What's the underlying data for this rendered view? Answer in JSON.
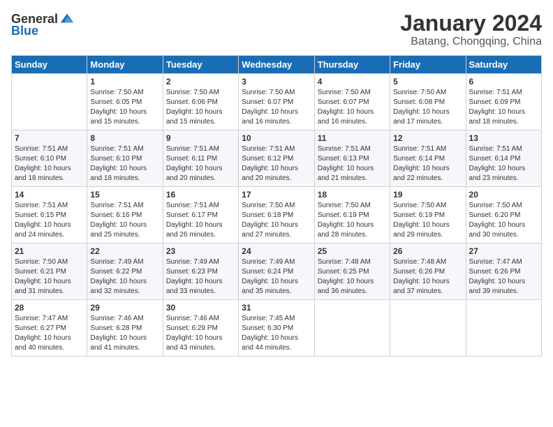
{
  "header": {
    "logo_general": "General",
    "logo_blue": "Blue",
    "title": "January 2024",
    "subtitle": "Batang, Chongqing, China"
  },
  "calendar": {
    "days_of_week": [
      "Sunday",
      "Monday",
      "Tuesday",
      "Wednesday",
      "Thursday",
      "Friday",
      "Saturday"
    ],
    "weeks": [
      [
        {
          "day": "",
          "sunrise": "",
          "sunset": "",
          "daylight": ""
        },
        {
          "day": "1",
          "sunrise": "7:50 AM",
          "sunset": "6:05 PM",
          "daylight": "10 hours and 15 minutes."
        },
        {
          "day": "2",
          "sunrise": "7:50 AM",
          "sunset": "6:06 PM",
          "daylight": "10 hours and 15 minutes."
        },
        {
          "day": "3",
          "sunrise": "7:50 AM",
          "sunset": "6:07 PM",
          "daylight": "10 hours and 16 minutes."
        },
        {
          "day": "4",
          "sunrise": "7:50 AM",
          "sunset": "6:07 PM",
          "daylight": "10 hours and 16 minutes."
        },
        {
          "day": "5",
          "sunrise": "7:50 AM",
          "sunset": "6:08 PM",
          "daylight": "10 hours and 17 minutes."
        },
        {
          "day": "6",
          "sunrise": "7:51 AM",
          "sunset": "6:09 PM",
          "daylight": "10 hours and 18 minutes."
        }
      ],
      [
        {
          "day": "7",
          "sunrise": "7:51 AM",
          "sunset": "6:10 PM",
          "daylight": "10 hours and 18 minutes."
        },
        {
          "day": "8",
          "sunrise": "7:51 AM",
          "sunset": "6:10 PM",
          "daylight": "10 hours and 18 minutes."
        },
        {
          "day": "9",
          "sunrise": "7:51 AM",
          "sunset": "6:11 PM",
          "daylight": "10 hours and 20 minutes."
        },
        {
          "day": "10",
          "sunrise": "7:51 AM",
          "sunset": "6:12 PM",
          "daylight": "10 hours and 20 minutes."
        },
        {
          "day": "11",
          "sunrise": "7:51 AM",
          "sunset": "6:13 PM",
          "daylight": "10 hours and 21 minutes."
        },
        {
          "day": "12",
          "sunrise": "7:51 AM",
          "sunset": "6:14 PM",
          "daylight": "10 hours and 22 minutes."
        },
        {
          "day": "13",
          "sunrise": "7:51 AM",
          "sunset": "6:14 PM",
          "daylight": "10 hours and 23 minutes."
        }
      ],
      [
        {
          "day": "14",
          "sunrise": "7:51 AM",
          "sunset": "6:15 PM",
          "daylight": "10 hours and 24 minutes."
        },
        {
          "day": "15",
          "sunrise": "7:51 AM",
          "sunset": "6:16 PM",
          "daylight": "10 hours and 25 minutes."
        },
        {
          "day": "16",
          "sunrise": "7:51 AM",
          "sunset": "6:17 PM",
          "daylight": "10 hours and 26 minutes."
        },
        {
          "day": "17",
          "sunrise": "7:50 AM",
          "sunset": "6:18 PM",
          "daylight": "10 hours and 27 minutes."
        },
        {
          "day": "18",
          "sunrise": "7:50 AM",
          "sunset": "6:19 PM",
          "daylight": "10 hours and 28 minutes."
        },
        {
          "day": "19",
          "sunrise": "7:50 AM",
          "sunset": "6:19 PM",
          "daylight": "10 hours and 29 minutes."
        },
        {
          "day": "20",
          "sunrise": "7:50 AM",
          "sunset": "6:20 PM",
          "daylight": "10 hours and 30 minutes."
        }
      ],
      [
        {
          "day": "21",
          "sunrise": "7:50 AM",
          "sunset": "6:21 PM",
          "daylight": "10 hours and 31 minutes."
        },
        {
          "day": "22",
          "sunrise": "7:49 AM",
          "sunset": "6:22 PM",
          "daylight": "10 hours and 32 minutes."
        },
        {
          "day": "23",
          "sunrise": "7:49 AM",
          "sunset": "6:23 PM",
          "daylight": "10 hours and 33 minutes."
        },
        {
          "day": "24",
          "sunrise": "7:49 AM",
          "sunset": "6:24 PM",
          "daylight": "10 hours and 35 minutes."
        },
        {
          "day": "25",
          "sunrise": "7:48 AM",
          "sunset": "6:25 PM",
          "daylight": "10 hours and 36 minutes."
        },
        {
          "day": "26",
          "sunrise": "7:48 AM",
          "sunset": "6:26 PM",
          "daylight": "10 hours and 37 minutes."
        },
        {
          "day": "27",
          "sunrise": "7:47 AM",
          "sunset": "6:26 PM",
          "daylight": "10 hours and 39 minutes."
        }
      ],
      [
        {
          "day": "28",
          "sunrise": "7:47 AM",
          "sunset": "6:27 PM",
          "daylight": "10 hours and 40 minutes."
        },
        {
          "day": "29",
          "sunrise": "7:46 AM",
          "sunset": "6:28 PM",
          "daylight": "10 hours and 41 minutes."
        },
        {
          "day": "30",
          "sunrise": "7:46 AM",
          "sunset": "6:29 PM",
          "daylight": "10 hours and 43 minutes."
        },
        {
          "day": "31",
          "sunrise": "7:45 AM",
          "sunset": "6:30 PM",
          "daylight": "10 hours and 44 minutes."
        },
        {
          "day": "",
          "sunrise": "",
          "sunset": "",
          "daylight": ""
        },
        {
          "day": "",
          "sunrise": "",
          "sunset": "",
          "daylight": ""
        },
        {
          "day": "",
          "sunrise": "",
          "sunset": "",
          "daylight": ""
        }
      ]
    ]
  }
}
